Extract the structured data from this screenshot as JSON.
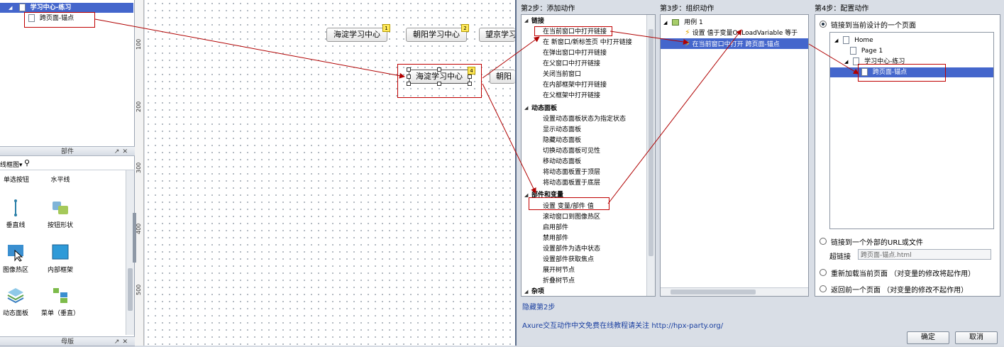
{
  "left_panel": {
    "tree_selected": "学习中心-练习",
    "tree_child": "跨页面-锚点",
    "widgets_pane_title": "部件",
    "library_dropdown": "线框图",
    "widgets": [
      {
        "label": "单选按钮",
        "icon": "radio-button-icon"
      },
      {
        "label": "水平线",
        "icon": "horizontal-line-icon"
      },
      {
        "label": "垂直线",
        "icon": "vertical-line-icon"
      },
      {
        "label": "按钮形状",
        "icon": "button-shape-icon"
      },
      {
        "label": "图像热区",
        "icon": "image-hotspot-icon"
      },
      {
        "label": "内部框架",
        "icon": "inline-frame-icon"
      },
      {
        "label": "动态面板",
        "icon": "dynamic-panel-icon"
      },
      {
        "label": "菜单（垂直）",
        "icon": "vertical-menu-icon"
      }
    ],
    "masters_pane_title": "母版"
  },
  "ruler": {
    "labels": [
      "100",
      "200",
      "300",
      "400",
      "500"
    ]
  },
  "canvas": {
    "buttons": [
      {
        "label": "海淀学习中心",
        "badge": "1"
      },
      {
        "label": "朝阳学习中心",
        "badge": "2"
      },
      {
        "label": "望京学习",
        "badge": ""
      },
      {
        "label": "海淀学习中心",
        "badge": "4"
      },
      {
        "label": "朝阳",
        "badge": ""
      }
    ]
  },
  "dialog": {
    "step2": {
      "title": "第2步：添加动作",
      "groups": [
        {
          "name": "链接",
          "items": [
            "在当前窗口中打开链接",
            "在 新窗口/新标签页 中打开链接",
            "在弹出窗口中打开链接",
            "在父窗口中打开链接",
            "关闭当前窗口",
            "在内部框架中打开链接",
            "在父框架中打开链接"
          ]
        },
        {
          "name": "动态面板",
          "items": [
            "设置动态面板状态为指定状态",
            "显示动态面板",
            "隐藏动态面板",
            "切换动态面板可见性",
            "移动动态面板",
            "将动态面板置于顶层",
            "将动态面板置于底层"
          ]
        },
        {
          "name": "部件和变量",
          "items": [
            "设置 变量/部件 值",
            "滚动窗口到图像热区",
            "启用部件",
            "禁用部件",
            "设置部件为选中状态",
            "设置部件获取焦点",
            "展开树节点",
            "折叠树节点"
          ]
        },
        {
          "name": "杂项",
          "items": []
        }
      ],
      "hide_link": "隐藏第2步"
    },
    "step3": {
      "title": "第3步：组织动作",
      "case_label": "用例 1",
      "actions": [
        "设置 值于变量OnLoadVariable 等于",
        "在当前窗口中打开 跨页面-锚点"
      ]
    },
    "step4": {
      "title": "第4步：配置动作",
      "option1": "链接到当前设计的一个页面",
      "pages": [
        "Home",
        "Page 1",
        "学习中心-练习",
        "跨页面-锚点"
      ],
      "option2": "链接到一个外部的URL或文件",
      "hyperlink_label": "超链接",
      "hyperlink_value": "跨页面-锚点.html",
      "option3": "重新加载当前页面 （对变量的修改将起作用）",
      "option4": "返回前一个页面 （对变量的修改不起作用）"
    },
    "footer_note": "Axure交互动作中文免费在线教程请关注 http://hpx-party.org/",
    "ok_label": "确定",
    "cancel_label": "取消"
  }
}
